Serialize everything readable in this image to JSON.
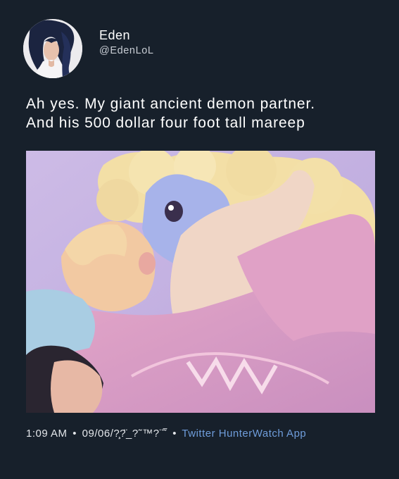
{
  "author": {
    "name": "Eden",
    "handle": "@EdenLoL",
    "avatar_icon": "profile-avatar"
  },
  "tweet": {
    "lines": [
      "Ah yes. My giant ancient demon partner.",
      "And his 500 dollar four foot tall mareep"
    ]
  },
  "media": {
    "description_icon": "illustration-image"
  },
  "meta": {
    "time": "1:09 AM",
    "date": "09/06/?̧?̈_?˜™?¨̃‾",
    "separator": "•",
    "source": "Twitter HunterWatch App"
  },
  "colors": {
    "background": "#17202b",
    "text": "#ffffff",
    "handle": "#c7ccd3",
    "link": "#6f9ddb"
  }
}
